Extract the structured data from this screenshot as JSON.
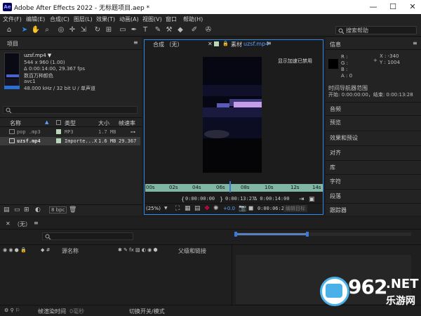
{
  "window": {
    "app_icon": "Ae",
    "title": "Adobe After Effects 2022 - 无标题项目.aep *",
    "minimize": "—",
    "maximize": "☐",
    "close": "✕"
  },
  "menu": [
    "文件(F)",
    "编辑(E)",
    "合成(C)",
    "图层(L)",
    "效果(T)",
    "动画(A)",
    "视图(V)",
    "窗口",
    "帮助(H)"
  ],
  "toolbar": {
    "align_label": "对齐",
    "search_placeholder": "搜索帮助"
  },
  "project": {
    "tab": "项目",
    "menu_icon": "≡",
    "selected_name": "uzsf.mp4 ▼",
    "selected_dims": "544 x 960 (1.00)",
    "selected_dur": "Δ 0:00:14:00, 29.367 fps",
    "selected_colors": "数百万种颜色",
    "selected_codec": "avc1",
    "selected_audio": "48.000 kHz / 32 bit U / 单声道",
    "columns": [
      "名称",
      "类型",
      "大小",
      "帧速率"
    ],
    "rows": [
      {
        "name": "pop .mp3",
        "type": "MP3",
        "size": "1.7 MB",
        "fps": ""
      },
      {
        "name": "uzsf.mp4",
        "type": "Importe...X",
        "size": "1.6 MB",
        "fps": "29.367"
      }
    ],
    "bpc": "8 bpc"
  },
  "viewer": {
    "comp_tab": "合成 （无）",
    "footage_tab": "素材",
    "footage_name": "uzsf.mp4",
    "accel_msg": "显示加速已禁用",
    "ruler_ticks": [
      "00s",
      "02s",
      "04s",
      "06s",
      "08s",
      "10s",
      "12s",
      "14s"
    ],
    "time_in": "0:00:00:00",
    "time_out": "0:00:13:27",
    "time_dur": "Δ 0:00:14:00",
    "zoom": "(25%)",
    "exposure": "+0.0",
    "current_time": "0:00:06:24",
    "edit_original": "编辑目标"
  },
  "info": {
    "tab": "信息",
    "r": "R :",
    "g": "G :",
    "b": "B :",
    "a": "A : 0",
    "x": "X : -340",
    "y": "Y : 1004",
    "range_title": "时间导航器范围",
    "range_value": "开始: 0:00:00:00，结束: 0:00:13:28",
    "panels": [
      "音频",
      "预览",
      "效果和预设",
      "对齐",
      "库",
      "字符",
      "段落",
      "跟踪器"
    ]
  },
  "timeline": {
    "tab": "（无）",
    "col_source": "源名称",
    "col_parent": "父级和链接",
    "footer_left": "帧渲染时间",
    "footer_ms": "0毫秒",
    "footer_toggle": "切换开关/模式"
  },
  "watermark": {
    "num": "962",
    "net": ".NET",
    "cn": "乐游网"
  },
  "colors": {
    "accent": "#2d8ceb",
    "ruler": "#7fb6a4",
    "panel": "#232323"
  }
}
